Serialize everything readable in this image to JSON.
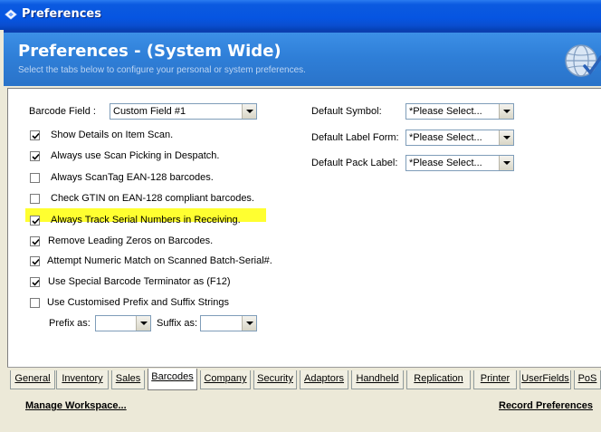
{
  "window": {
    "title": "Preferences"
  },
  "header": {
    "title": "Preferences - (System Wide)",
    "subtitle": "Select the tabs below to configure your personal or system preferences."
  },
  "barcode_field": {
    "label": "Barcode Field :",
    "value": "Custom Field #1"
  },
  "checkboxes": [
    {
      "label": "Show Details on Item Scan.",
      "checked": true
    },
    {
      "label": "Always use Scan Picking in Despatch.",
      "checked": true
    },
    {
      "label": "Always ScanTag EAN-128 barcodes.",
      "checked": false
    },
    {
      "label": "Check GTIN on EAN-128 compliant barcodes.",
      "checked": false
    },
    {
      "label": "Always Track Serial Numbers in Receiving.",
      "checked": true
    },
    {
      "label": "Remove Leading Zeros on Barcodes.",
      "checked": true
    },
    {
      "label": "Attempt Numeric Match on Scanned Batch-Serial#.",
      "checked": true
    },
    {
      "label": "Use Special Barcode Terminator as (F12)",
      "checked": true
    },
    {
      "label": "Use Customised Prefix and Suffix Strings",
      "checked": false
    }
  ],
  "prefix": {
    "label": "Prefix as:",
    "value": ""
  },
  "suffix": {
    "label": "Suffix as:",
    "value": ""
  },
  "defaults": [
    {
      "label": "Default Symbol:",
      "value": "*Please Select..."
    },
    {
      "label": "Default Label Form:",
      "value": "*Please Select..."
    },
    {
      "label": "Default Pack Label:",
      "value": "*Please Select..."
    }
  ],
  "tabs": [
    "General",
    "Inventory",
    "Sales",
    "Barcodes",
    "Company",
    "Security",
    "Adaptors",
    "Handheld",
    "Replication",
    "Printer",
    "UserFields",
    "PoS"
  ],
  "active_tab": "Barcodes",
  "footer": {
    "manage": "Manage Workspace...",
    "record": "Record Preferences"
  },
  "colors": {
    "title_bar": "#0655e1",
    "header": "#2f7fd8",
    "highlight": "#ffff30"
  }
}
